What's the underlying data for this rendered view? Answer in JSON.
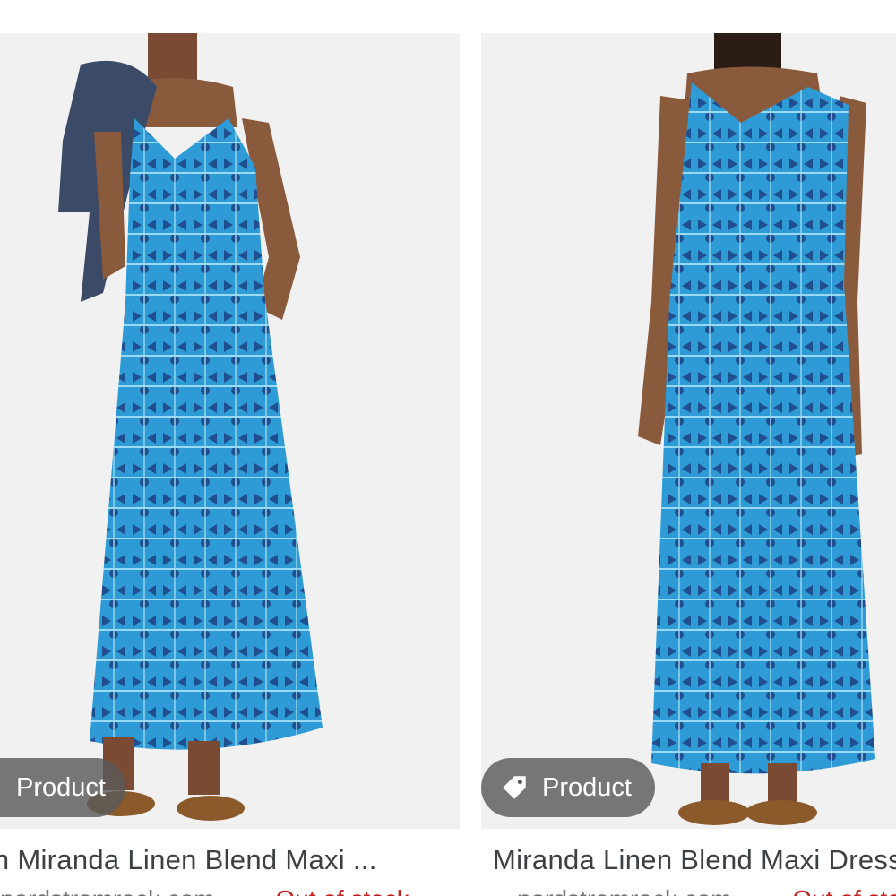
{
  "results": [
    {
      "badge_label": "Product",
      "badge_icon": "tag-icon",
      "title": "Allen Miranda Linen Blend Maxi ...",
      "store": "nordstromrack.com",
      "stock": "Out of stock"
    },
    {
      "badge_label": "Product",
      "badge_icon": "tag-icon",
      "title": "Miranda Linen Blend Maxi Dress",
      "store": "nordstromrack.com",
      "stock": "Out of stock"
    }
  ],
  "colors": {
    "dress_blue": "#2e9bd6",
    "dress_dark": "#1f4f8f",
    "badge_bg": "#5a5a5a",
    "stock_red": "#c5221f"
  }
}
